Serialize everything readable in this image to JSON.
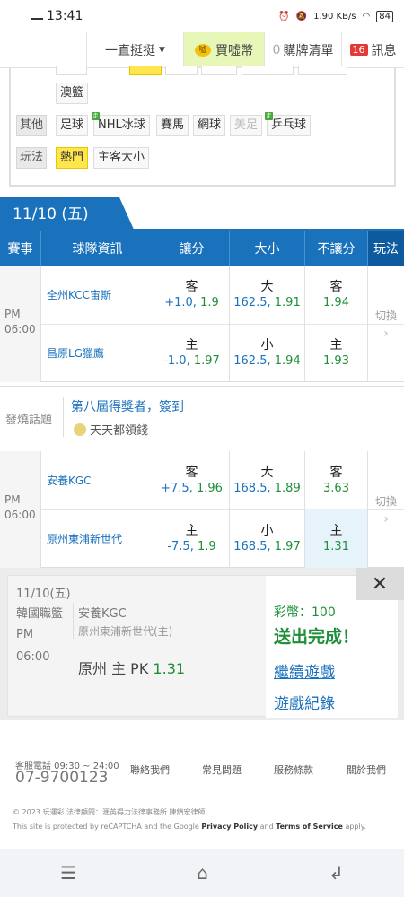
{
  "status_bar": {
    "time": "13:41",
    "net_speed": "1.90 KB/s",
    "battery": "84"
  },
  "top_nav": {
    "dropdown_label": "一直挺挺",
    "coin_button": "買噓幣",
    "coin_icon_text": "噓",
    "cart_count": "0",
    "cart_label": "購牌清單",
    "msg_count": "16",
    "msg_label": "訊息"
  },
  "filter": {
    "row_aus": "澳籃",
    "other_label": "其他",
    "other_items": [
      "足球",
      "NHL冰球",
      "賽馬",
      "網球",
      "美足",
      "乒乓球"
    ],
    "play_label": "玩法",
    "play_items": [
      "熱門",
      "主客大小"
    ],
    "badge": "走"
  },
  "date_tab": "11/10 (五)",
  "table_header": [
    "賽事",
    "球隊資訊",
    "讓分",
    "大小",
    "不讓分",
    "玩法"
  ],
  "matches": [
    {
      "period": "PM",
      "time": "06:00",
      "teams": [
        "全州KCC宙斯",
        "昌原LG獵鷹"
      ],
      "spread": [
        {
          "k": "客",
          "line": "+1.0,",
          "odds": "1.9"
        },
        {
          "k": "主",
          "line": "-1.0,",
          "odds": "1.97"
        }
      ],
      "total": [
        {
          "k": "大",
          "line": "162.5,",
          "odds": "1.91"
        },
        {
          "k": "小",
          "line": "162.5,",
          "odds": "1.94"
        }
      ],
      "moneyline": [
        {
          "k": "客",
          "odds": "1.94"
        },
        {
          "k": "主",
          "odds": "1.93"
        }
      ],
      "switch": "切換"
    },
    {
      "period": "PM",
      "time": "06:00",
      "teams": [
        "安養KGC",
        "原州東浦新世代"
      ],
      "spread": [
        {
          "k": "客",
          "line": "+7.5,",
          "odds": "1.96"
        },
        {
          "k": "主",
          "line": "-7.5,",
          "odds": "1.9"
        }
      ],
      "total": [
        {
          "k": "大",
          "line": "168.5,",
          "odds": "1.89"
        },
        {
          "k": "小",
          "line": "168.5,",
          "odds": "1.97"
        }
      ],
      "moneyline": [
        {
          "k": "客",
          "odds": "3.63"
        },
        {
          "k": "主",
          "odds": "1.31"
        }
      ],
      "switch": "切換"
    }
  ],
  "promo": {
    "label": "發燒話題",
    "title": "第八屆得獎者，簽到",
    "subtitle": "天天都領錢"
  },
  "bet_slip": {
    "date": "11/10(五)",
    "league": "韓國職籃",
    "period": "PM",
    "time": "06:00",
    "away_team": "安養KGC",
    "home_team": "原州東浦新世代(主)",
    "pick_prefix": "原州 主 PK",
    "pick_odds": "1.31",
    "coins": "彩幣：100",
    "done": "送出完成！",
    "continue_link": "繼續遊戲",
    "record_link": "遊戲紀錄",
    "close": "✕"
  },
  "footer": {
    "service_hours": "客服電話 09:30 ~ 24:00",
    "phone": "07-9700123",
    "links": [
      "聯絡我們",
      "常見問題",
      "服務條款",
      "關於我們"
    ],
    "copyright": "© 2023 玩運彩 法律顧問：滙英得力法律事務所 陳鎮宏律師",
    "recaptcha_pre": "This site is protected by reCAPTCHA and the Google ",
    "privacy": "Privacy Policy",
    "and": " and ",
    "terms": "Terms of Service",
    "apply": " apply."
  }
}
